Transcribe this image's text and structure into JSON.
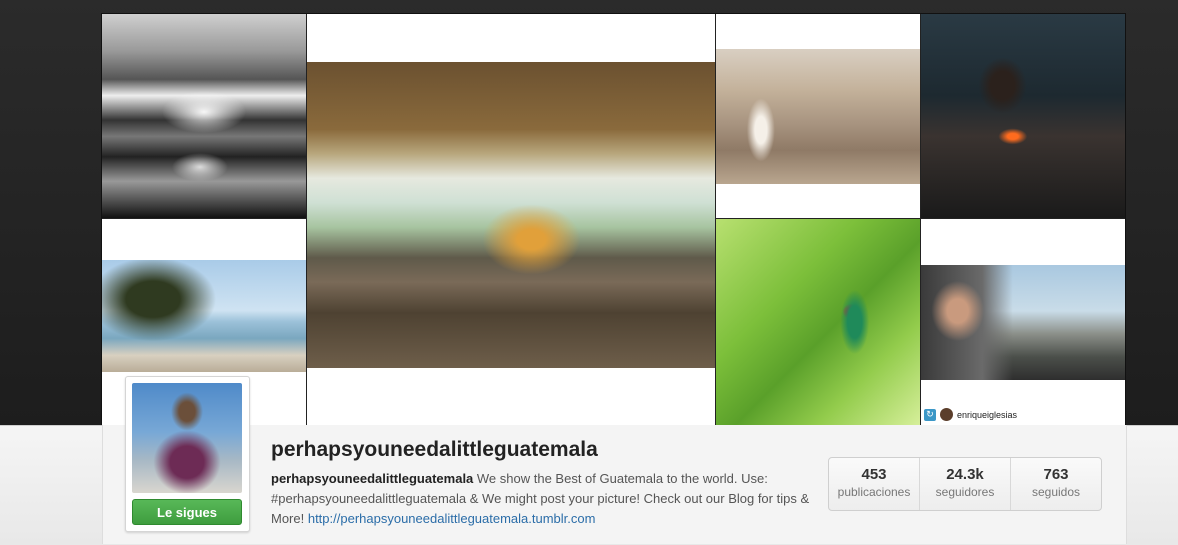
{
  "profile": {
    "username": "perhapsyouneedalittleguatemala",
    "follow_button_label": "Le sigues",
    "bio_username": "perhapsyouneedalittleguatemala",
    "bio_text": " We show the Best of Guatemala to the world. Use: #perhapsyouneedalittleguatemala & We might post your picture! Check out our Blog for tips & More! ",
    "bio_link": "http://perhapsyouneedalittleguatemala.tumblr.com"
  },
  "stats": [
    {
      "value": "453",
      "label": "publicaciones"
    },
    {
      "value": "24.3k",
      "label": "seguidores"
    },
    {
      "value": "763",
      "label": "seguidos"
    }
  ],
  "grid": {
    "credit_username": "enriqueiglesias",
    "repost_icon": "repost-icon"
  },
  "colors": {
    "follow_green": "#3e9d3e",
    "link_blue": "#2b6da8"
  }
}
